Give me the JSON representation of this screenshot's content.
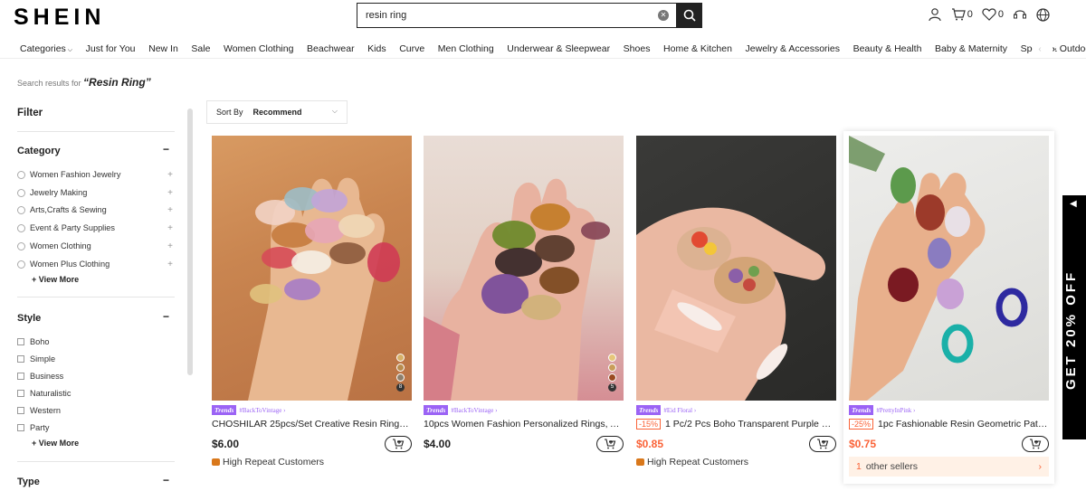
{
  "header": {
    "logo": "SHEIN",
    "search_value": "resin ring",
    "cart_count": "0",
    "wishlist_count": "0"
  },
  "nav": {
    "items": [
      "Categories",
      "Just for You",
      "New In",
      "Sale",
      "Women Clothing",
      "Beachwear",
      "Kids",
      "Curve",
      "Men Clothing",
      "Underwear & Sleepwear",
      "Shoes",
      "Home & Kitchen",
      "Jewelry & Accessories",
      "Beauty & Health",
      "Baby & Maternity",
      "Sports & Outdoor"
    ]
  },
  "results": {
    "prefix": "Search results for",
    "query": "“Resin Ring”"
  },
  "sidebar": {
    "filter_title": "Filter",
    "category": {
      "title": "Category",
      "items": [
        "Women Fashion Jewelry",
        "Jewelry Making",
        "Arts,Crafts & Sewing",
        "Event & Party Supplies",
        "Women Clothing",
        "Women Plus Clothing"
      ],
      "view_more": "View More"
    },
    "style": {
      "title": "Style",
      "items": [
        "Boho",
        "Simple",
        "Business",
        "Naturalistic",
        "Western",
        "Party"
      ],
      "view_more": "View More"
    },
    "type": {
      "title": "Type"
    }
  },
  "sort": {
    "label": "Sort By",
    "value": "Recommend"
  },
  "products": [
    {
      "trend_tag": "#BackToVintage",
      "title": "CHOSHILAR 25pcs/Set Creative Resin Rings Per...",
      "price": "$6.00",
      "badge": "High Repeat Customers",
      "swatch_count": "8"
    },
    {
      "trend_tag": "#BackToVintage",
      "title": "10pcs Women Fashion Personalized Rings, Acryl...",
      "price": "$4.00",
      "swatch_count": "5"
    },
    {
      "trend_tag": "#Eid Floral",
      "discount": "-15%",
      "title": "1 Pc/2 Pcs Boho Transparent Purple Green Resi...",
      "price": "$0.85",
      "badge": "High Repeat Customers"
    },
    {
      "trend_tag": "#PrettyInPink",
      "discount": "-25%",
      "title": "1pc Fashionable Resin Geometric Pattern Ring...",
      "price": "$0.75",
      "sellers_count": "1",
      "sellers_text": "other sellers"
    }
  ],
  "trend_label": "Trends",
  "promo": {
    "text": "GET 20% OFF"
  }
}
